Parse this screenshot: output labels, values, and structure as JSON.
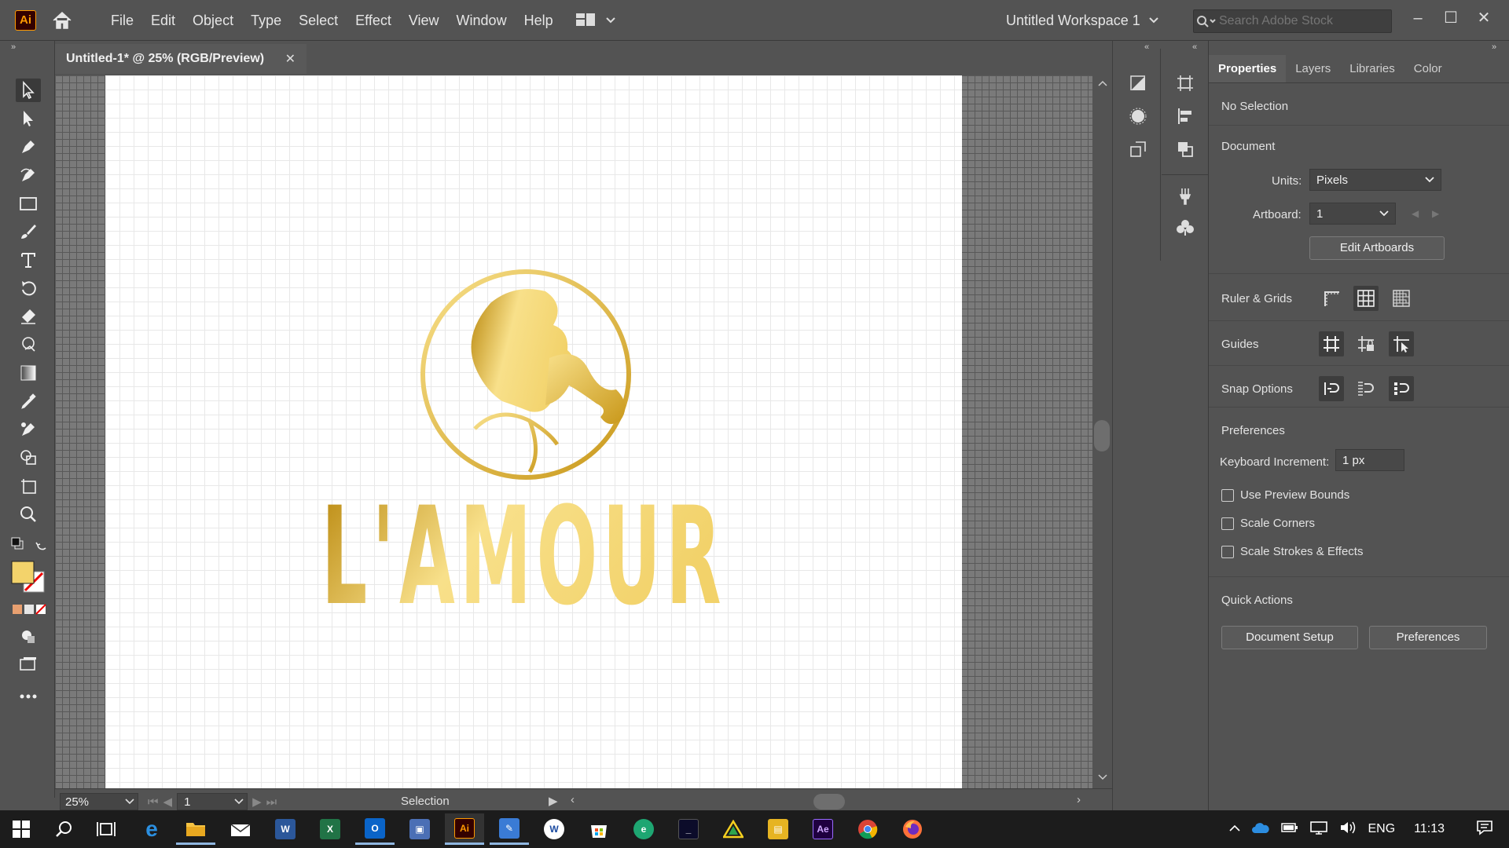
{
  "app": {
    "logo": "Ai",
    "accent": "#ff9a00"
  },
  "menu": [
    "File",
    "Edit",
    "Object",
    "Type",
    "Select",
    "Effect",
    "View",
    "Window",
    "Help"
  ],
  "workspace": {
    "label": "Untitled Workspace 1"
  },
  "stock_search": {
    "placeholder": "Search Adobe Stock"
  },
  "window_controls": {
    "minimize": "–",
    "maximize": "☐",
    "close": "✕"
  },
  "document": {
    "tab_title": "Untitled-1* @ 25% (RGB/Preview)",
    "close": "✕"
  },
  "artwork": {
    "brand_text": "L'AMOUR",
    "gold_light": "#f8e08a",
    "gold_dark": "#b8860b"
  },
  "statusbar": {
    "zoom": "25%",
    "artboard": "1",
    "tool": "Selection"
  },
  "panel": {
    "tabs": [
      "Properties",
      "Layers",
      "Libraries",
      "Color"
    ],
    "selection": "No Selection",
    "document_heading": "Document",
    "units_label": "Units:",
    "units_value": "Pixels",
    "artboard_label": "Artboard:",
    "artboard_value": "1",
    "edit_artboards": "Edit Artboards",
    "ruler_grids": "Ruler & Grids",
    "guides": "Guides",
    "snap_options": "Snap Options",
    "preferences_heading": "Preferences",
    "keyboard_increment_label": "Keyboard Increment:",
    "keyboard_increment_value": "1 px",
    "use_preview_bounds": "Use Preview Bounds",
    "scale_corners": "Scale Corners",
    "scale_strokes": "Scale Strokes & Effects",
    "quick_actions": "Quick Actions",
    "document_setup": "Document Setup",
    "preferences_button": "Preferences"
  },
  "taskbar": {
    "language": "ENG",
    "time": "11:13",
    "apps": [
      "start",
      "search",
      "task-view",
      "edge",
      "file-explorer",
      "mail",
      "word",
      "excel",
      "outlook",
      "app-generic",
      "illustrator",
      "app-paint",
      "app-w",
      "store",
      "edge-beta",
      "terminal",
      "app-triangle",
      "app-chart",
      "after-effects",
      "chrome",
      "firefox"
    ]
  }
}
